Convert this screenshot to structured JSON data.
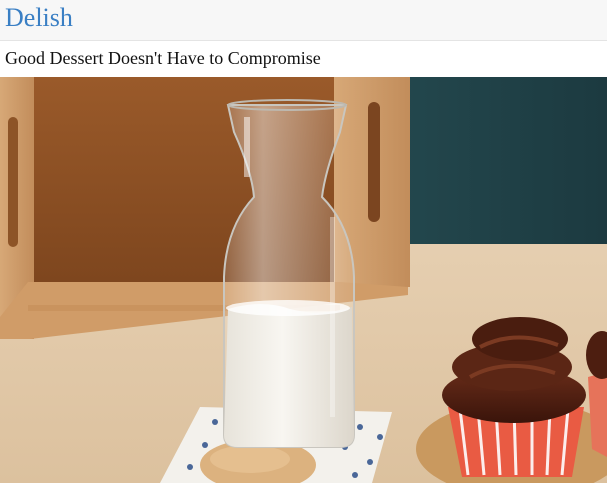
{
  "site": {
    "brand": "Delish"
  },
  "article": {
    "headline": "Good Dessert Doesn't Have to Compromise"
  },
  "hero_image": {
    "objects": [
      "milk-carafe",
      "wooden-crate",
      "napkin",
      "wooden-spoon",
      "chocolate-cupcake"
    ]
  },
  "colors": {
    "brand": "#3a7fc4",
    "text": "#111111",
    "topbar": "#f7f7f7"
  }
}
